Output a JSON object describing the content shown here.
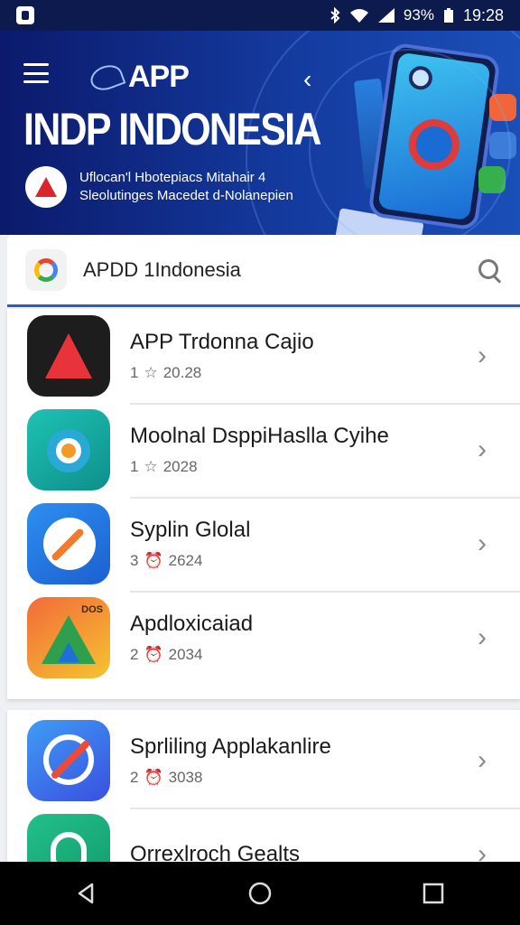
{
  "status_bar": {
    "battery": "93%",
    "time": "19:28"
  },
  "hero": {
    "small_title": "APP",
    "title": "INDP INDONESIA",
    "line1": "Uflocan'l Hbotepiacs Mitahair 4",
    "line2": "Sleolutinges Macedet d-Nolanepien"
  },
  "search": {
    "text": "APDD 1Indonesia"
  },
  "list": [
    {
      "title": "APP Trdonna Cajio",
      "rank": "1",
      "meta": "20.28",
      "badge": "star"
    },
    {
      "title": "Moolnal DsppiHaslla Cyihe",
      "rank": "1",
      "meta": "2028",
      "badge": "star"
    },
    {
      "title": "Syplin Glolal",
      "rank": "3",
      "meta": "2624",
      "badge": "alarm"
    },
    {
      "title": "Apdloxicaiad",
      "rank": "2",
      "meta": "2034",
      "badge": "alarm",
      "icon_tag": "DOS"
    }
  ],
  "list2": [
    {
      "title": "Sprliling Applakanlire",
      "rank": "2",
      "meta": "3038",
      "badge": "alarm"
    },
    {
      "title": "Orrexlroch Gealts",
      "rank": "",
      "meta": "",
      "badge": ""
    }
  ],
  "colors": {
    "hero_start": "#0b1a6b",
    "hero_end": "#1a4fb8",
    "accent_line": "#2c5bbf"
  }
}
